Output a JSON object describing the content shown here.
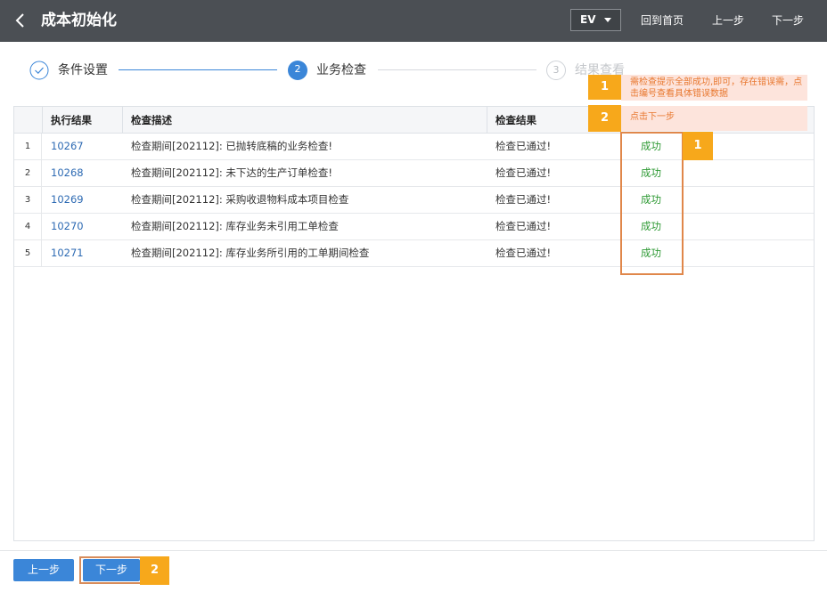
{
  "header": {
    "title": "成本初始化",
    "ev_label": "EV",
    "home_label": "回到首页",
    "prev_label": "上一步",
    "next_label": "下一步"
  },
  "steps": [
    {
      "number": "",
      "label": "条件设置",
      "state": "done"
    },
    {
      "number": "2",
      "label": "业务检查",
      "state": "active"
    },
    {
      "number": "3",
      "label": "结果查看",
      "state": "pending"
    }
  ],
  "callouts": {
    "c1_num": "1",
    "c1_text": "需检查提示全部成功,即可，存在错误需，点击编号查看具体错误数据",
    "c2_num": "2",
    "c2_text": "点击下一步",
    "c1_side_num": "1",
    "c2_button_num": "2"
  },
  "table": {
    "headers": [
      "执行结果",
      "检查描述",
      "检查结果"
    ],
    "rows": [
      {
        "num": "1",
        "id": "10267",
        "desc": "检查期间[202112]: 已抛转底稿的业务检查!",
        "result": "检查已通过!",
        "status": "成功"
      },
      {
        "num": "2",
        "id": "10268",
        "desc": "检查期间[202112]: 未下达的生产订单检查!",
        "result": "检查已通过!",
        "status": "成功"
      },
      {
        "num": "3",
        "id": "10269",
        "desc": "检查期间[202112]: 采购收退物料成本项目检查",
        "result": "检查已通过!",
        "status": "成功"
      },
      {
        "num": "4",
        "id": "10270",
        "desc": "检查期间[202112]: 库存业务未引用工单检查",
        "result": "检查已通过!",
        "status": "成功"
      },
      {
        "num": "5",
        "id": "10271",
        "desc": "检查期间[202112]: 库存业务所引用的工单期间检查",
        "result": "检查已通过!",
        "status": "成功"
      }
    ]
  },
  "footer": {
    "prev_label": "上一步",
    "next_label": "下一步"
  },
  "colors": {
    "topbar": "#4b4f54",
    "accent": "#3b86d8",
    "success": "#2f9a35",
    "callout": "#f7a81b",
    "callout_bg": "#fde4dc",
    "highlight": "#e0874a"
  }
}
